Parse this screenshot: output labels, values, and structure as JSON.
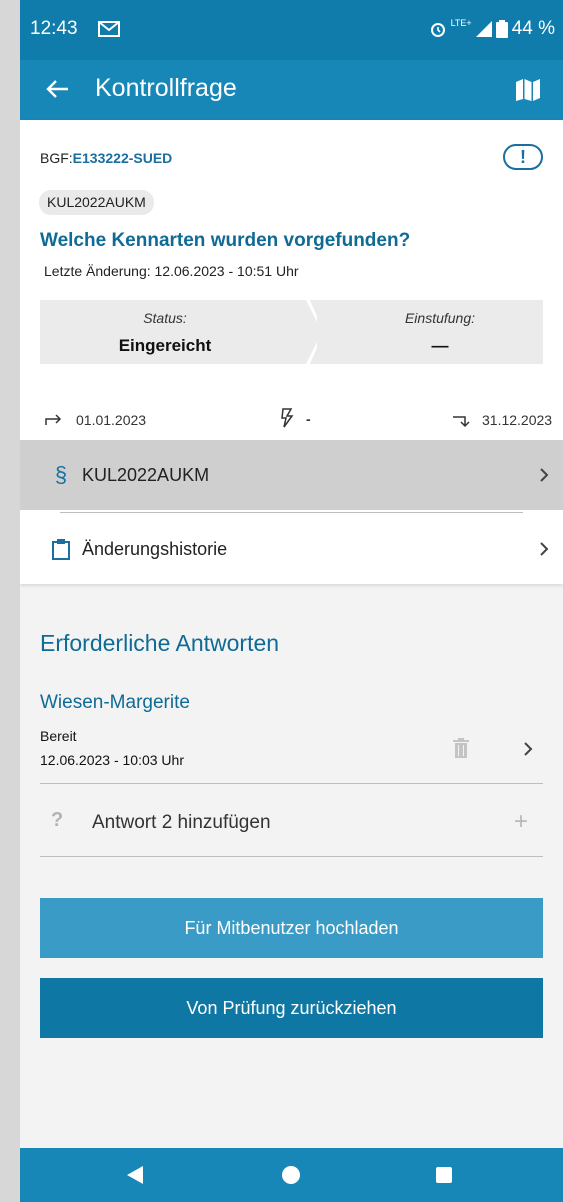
{
  "status_bar": {
    "time": "12:43",
    "network": "LTE+",
    "battery": "44 %",
    "icons": [
      "mail-icon",
      "alarm-icon",
      "signal-icon",
      "battery-icon"
    ]
  },
  "app_bar": {
    "title": "Kontrollfrage",
    "back_icon": "arrow-left-icon",
    "map_icon": "map-icon"
  },
  "card": {
    "bgf_prefix": "BGF:",
    "bgf_code": "E133222-SUED",
    "alert_symbol": "!",
    "chip": "KUL2022AUKM",
    "question": "Welche Kennarten wurden vorgefunden?",
    "last_change": "Letzte Änderung: 12.06.2023 - 10:51 Uhr",
    "status_label": "Status:",
    "status_value": "Eingereicht",
    "einstufung_label": "Einstufung:",
    "einstufung_value": "—",
    "date_start": "01.01.2023",
    "bolt_value": "-",
    "date_end": "31.12.2023",
    "rows": [
      {
        "icon": "§",
        "label": "KUL2022AUKM"
      },
      {
        "icon": "clipboard-icon",
        "label": "Änderungshistorie"
      }
    ]
  },
  "answers": {
    "section_title": "Erforderliche Antworten",
    "items": [
      {
        "title": "Wiesen-Margerite",
        "status": "Bereit",
        "date": "12.06.2023 - 10:03 Uhr"
      }
    ],
    "add_icon": "?",
    "add_label": "Antwort 2 hinzufügen",
    "add_plus": "+"
  },
  "buttons": {
    "upload": "Für Mitbenutzer hochladen",
    "withdraw": "Von Prüfung zurückziehen"
  },
  "colors": {
    "primary": "#1787b8",
    "primary_dark": "#0f6b96",
    "button_light": "#3a9cc6",
    "button_dark": "#0f77a3"
  }
}
